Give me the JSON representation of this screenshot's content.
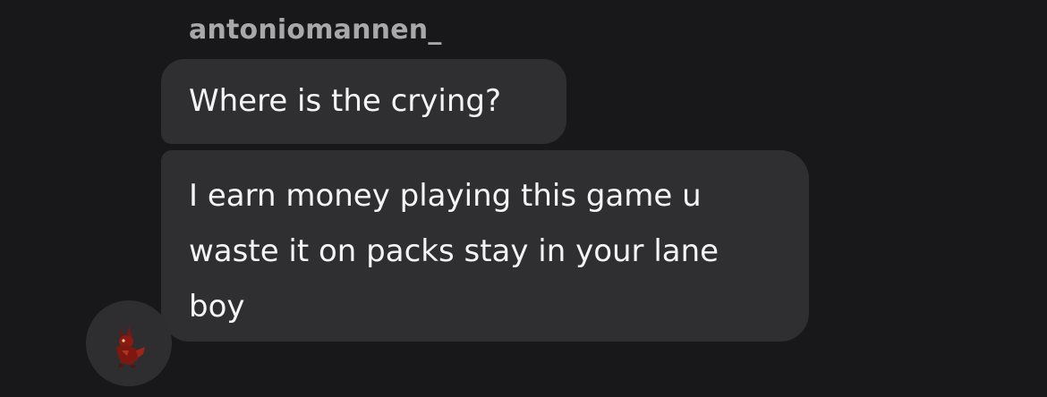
{
  "conversation": {
    "sender": {
      "username": "antoniomannen_",
      "avatar_icon": "red-fox-avatar-icon"
    },
    "messages": [
      {
        "text": "Where is the crying?"
      },
      {
        "lines": [
          "I earn money playing this game u",
          "waste it on packs stay in your lane",
          "boy"
        ]
      }
    ]
  },
  "colors": {
    "background": "#18181a",
    "bubble": "#2f2f31",
    "text": "#f4f4f5",
    "sender_name": "#a8a8ac",
    "avatar_accent": "#8b1a12"
  }
}
